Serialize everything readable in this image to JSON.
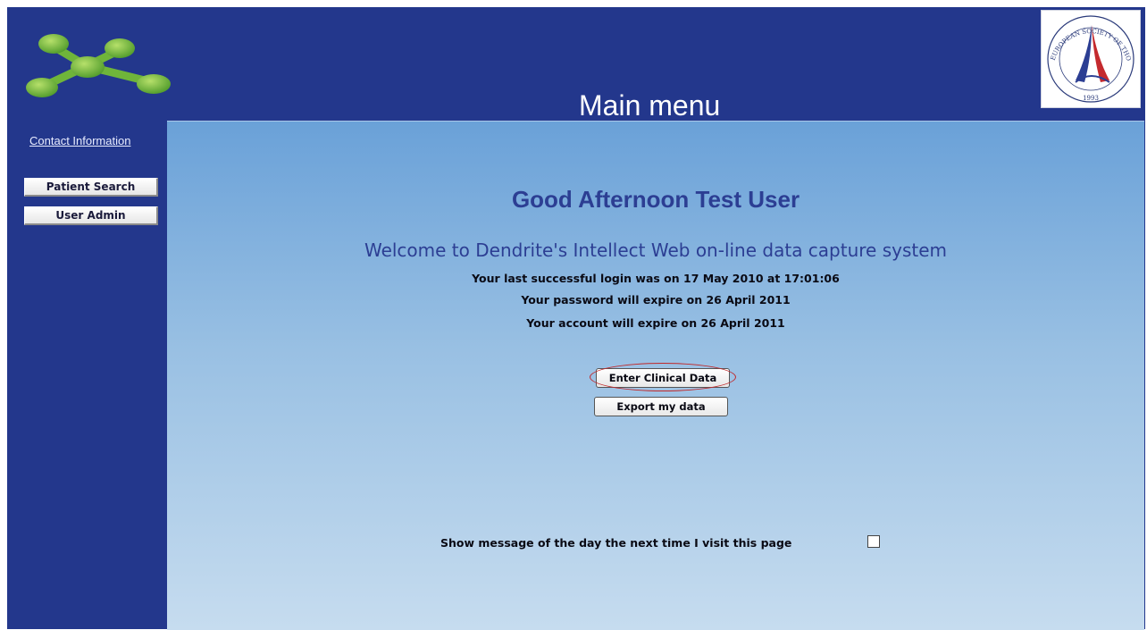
{
  "header": {
    "title": "Main menu",
    "logo_icon": "molecule-network-logo",
    "seal": {
      "icon": "society-seal-logo",
      "text_top": "EUROPEAN SOCIETY OF THORACIC SURGEONS",
      "year": "1993"
    }
  },
  "sidebar": {
    "contact_link": "Contact Information",
    "buttons": [
      "Patient Search",
      "User Admin"
    ]
  },
  "main": {
    "greeting": "Good Afternoon Test User",
    "welcome": "Welcome to Dendrite's Intellect Web on-line data capture system",
    "info": [
      "Your last successful login was on 17 May 2010 at 17:01:06",
      "Your password will expire on 26 April 2011",
      "Your account will expire on 26 April 2011"
    ],
    "enter_button": "Enter Clinical Data",
    "export_button": "Export my data",
    "motd_label": "Show message of the day the next time I visit this page",
    "motd_checked": false
  },
  "colors": {
    "frame": "#23378c",
    "content_top": "#6aa1d8",
    "content_bottom": "#c6dcef",
    "heading": "#2c3e93",
    "highlight": "#c0282a",
    "logo_green": "#7cc142"
  }
}
